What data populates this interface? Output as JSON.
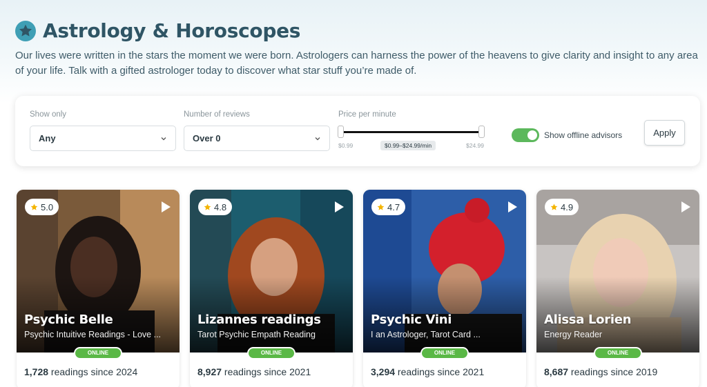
{
  "header": {
    "title": "Astrology & Horoscopes",
    "intro": "Our lives were written in the stars the moment we were born. Astrologers can harness the power of the heavens to give clarity and insight to any area of your life. Talk with a gifted astrologer today to discover what star stuff you’re made of.",
    "icon": "star-icon"
  },
  "filters": {
    "show_only": {
      "label": "Show only",
      "value": "Any"
    },
    "reviews": {
      "label": "Number of reviews",
      "value": "Over 0"
    },
    "price": {
      "label": "Price per minute",
      "min": "$0.99",
      "max": "$24.99",
      "range": "$0.99–$24.99/min"
    },
    "offline": {
      "label": "Show offline advisors",
      "enabled": true
    },
    "apply_label": "Apply"
  },
  "colors": {
    "title": "#2f5565",
    "online": "#5ab846",
    "toggle": "#5cb85c",
    "rating_star": "#f4b400"
  },
  "advisors": [
    {
      "rating": "5.0",
      "name": "Psychic Belle",
      "description": "Psychic Intuitive Readings - Love ...",
      "status": "ONLINE",
      "count": "1,728",
      "since": " readings since 2024"
    },
    {
      "rating": "4.8",
      "name": "Lizannes readings",
      "description": "Tarot Psychic Empath Reading",
      "status": "ONLINE",
      "count": "8,927",
      "since": " readings since 2021"
    },
    {
      "rating": "4.7",
      "name": "Psychic Vini",
      "description": "I an Astrologer, Tarot Card ...",
      "status": "ONLINE",
      "count": "3,294",
      "since": " readings since 2021"
    },
    {
      "rating": "4.9",
      "name": "Alissa Lorien",
      "description": "Energy Reader",
      "status": "ONLINE",
      "count": "8,687",
      "since": " readings since 2019"
    }
  ]
}
